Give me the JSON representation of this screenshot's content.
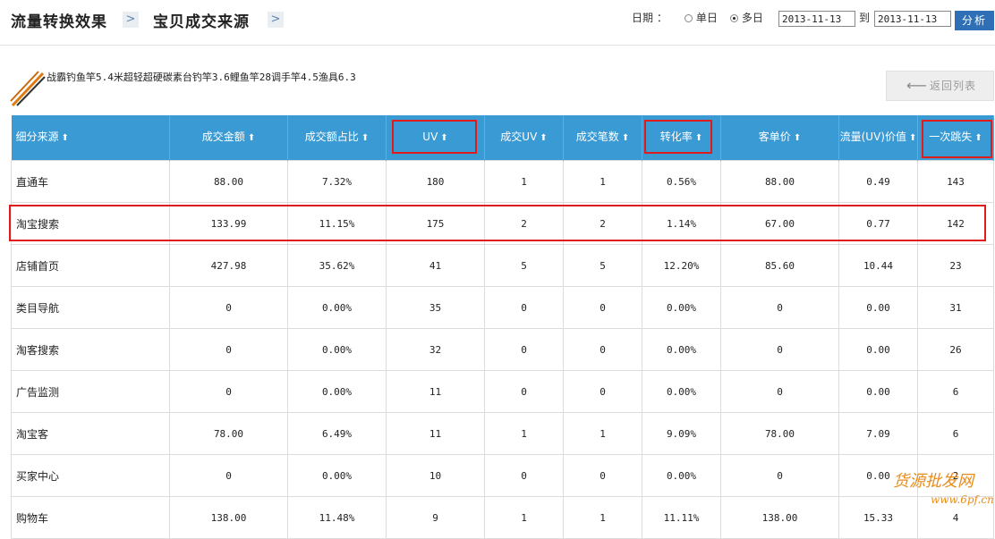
{
  "breadcrumb": {
    "level1": "流量转换效果",
    "level2": "宝贝成交来源",
    "sep": ">"
  },
  "date_filter": {
    "label": "日期 ：",
    "single_day": "单日",
    "multi_day": "多日",
    "selected": "多日",
    "start": "2013-11-13",
    "to": "到",
    "end": "2013-11-13",
    "analyze": "分析"
  },
  "product": {
    "title": "战霸钓鱼竿5.4米超轻超硬碳素台钓竿3.6鲤鱼竿28调手竿4.5渔具6.3"
  },
  "back_button": {
    "label": "返回列表"
  },
  "table": {
    "columns": [
      "细分来源",
      "成交金额",
      "成交额占比",
      "UV",
      "成交UV",
      "成交笔数",
      "转化率",
      "客单价",
      "流量(UV)价值",
      "一次跳失"
    ],
    "rows": [
      [
        "直通车",
        "88.00",
        "7.32%",
        "180",
        "1",
        "1",
        "0.56%",
        "88.00",
        "0.49",
        "143"
      ],
      [
        "淘宝搜索",
        "133.99",
        "11.15%",
        "175",
        "2",
        "2",
        "1.14%",
        "67.00",
        "0.77",
        "142"
      ],
      [
        "店铺首页",
        "427.98",
        "35.62%",
        "41",
        "5",
        "5",
        "12.20%",
        "85.60",
        "10.44",
        "23"
      ],
      [
        "类目导航",
        "0",
        "0.00%",
        "35",
        "0",
        "0",
        "0.00%",
        "0",
        "0.00",
        "31"
      ],
      [
        "淘客搜索",
        "0",
        "0.00%",
        "32",
        "0",
        "0",
        "0.00%",
        "0",
        "0.00",
        "26"
      ],
      [
        "广告监测",
        "0",
        "0.00%",
        "11",
        "0",
        "0",
        "0.00%",
        "0",
        "0.00",
        "6"
      ],
      [
        "淘宝客",
        "78.00",
        "6.49%",
        "11",
        "1",
        "1",
        "9.09%",
        "78.00",
        "7.09",
        "6"
      ],
      [
        "买家中心",
        "0",
        "0.00%",
        "10",
        "0",
        "0",
        "0.00%",
        "0",
        "0.00",
        "2"
      ],
      [
        "购物车",
        "138.00",
        "11.48%",
        "9",
        "1",
        "1",
        "11.11%",
        "138.00",
        "15.33",
        "4"
      ]
    ]
  },
  "watermark": {
    "text": "货源批发网",
    "url": "www.6pf.cn"
  },
  "colors": {
    "header_bg": "#3a9ad4",
    "highlight": "#e01b1b",
    "button": "#2e6fb5"
  }
}
